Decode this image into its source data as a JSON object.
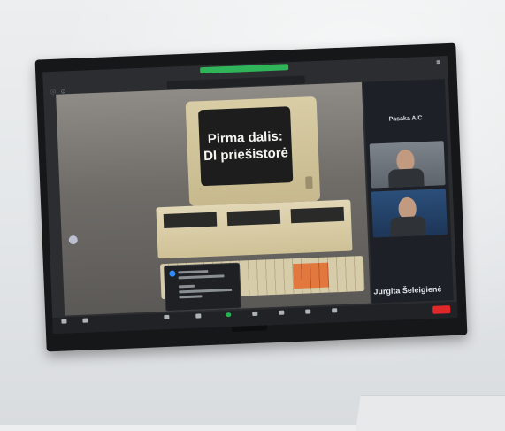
{
  "slide": {
    "title_line1": "Pirma dalis:",
    "title_line2": "DI priešistorė"
  },
  "participants_panel": {
    "header_name": "Pasaka A/C",
    "speaker_name": "Jurgita Šeleigienė"
  },
  "colors": {
    "meeting_banner": "#2fb45a",
    "end_button": "#e02828",
    "accent_blue": "#2d8cff"
  },
  "icons": [
    "mic-icon",
    "video-icon",
    "participants-icon",
    "chat-icon",
    "share-screen-icon",
    "record-icon",
    "reactions-icon",
    "apps-icon",
    "more-icon"
  ]
}
